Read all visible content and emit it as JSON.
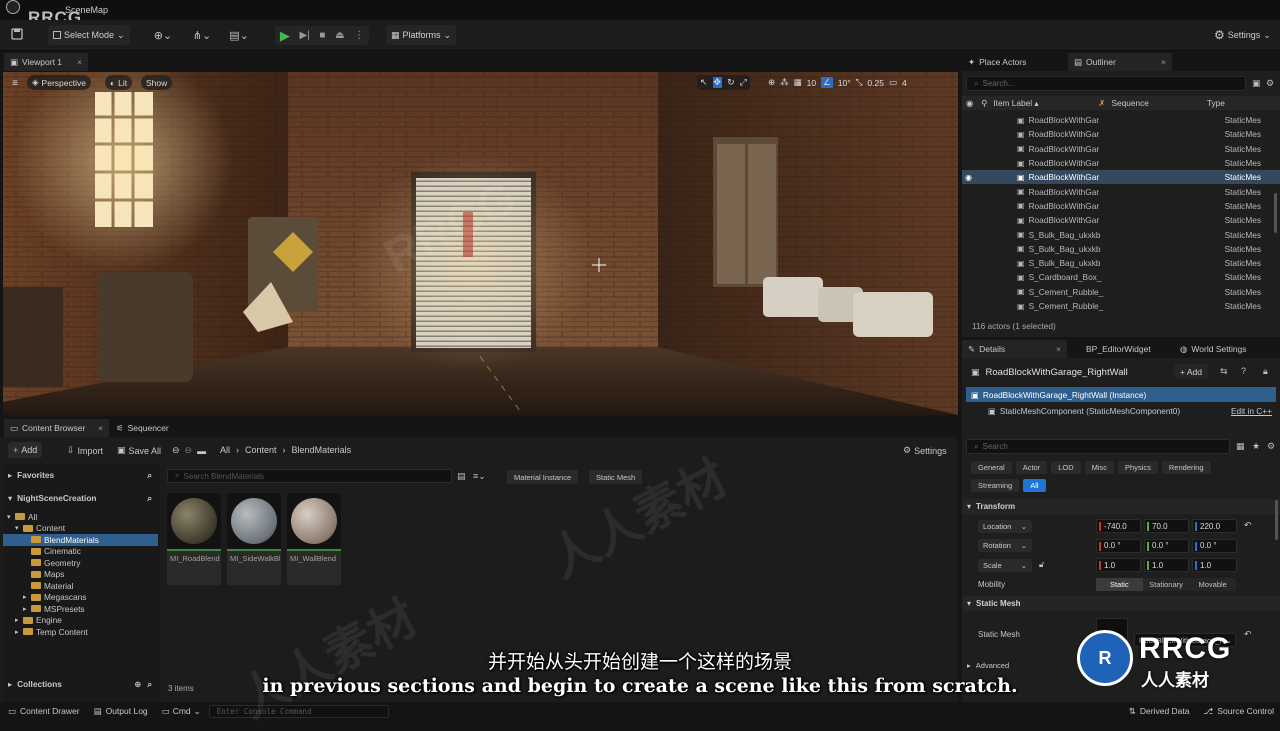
{
  "app": {
    "window_title": "SceneMap",
    "logo_text": "RRCG"
  },
  "toolbar": {
    "select_mode": "Select Mode",
    "platforms": "Platforms",
    "settings": "Settings"
  },
  "viewport": {
    "tab": "Viewport 1",
    "perspective": "Perspective",
    "lit": "Lit",
    "show": "Show",
    "angle_snap": "10°",
    "scale_snap": "0.25",
    "grid_snap": "10",
    "camera_speed": "4"
  },
  "outliner": {
    "tabs": [
      "Place Actors",
      "Outliner"
    ],
    "search_placeholder": "Search...",
    "columns": {
      "label": "Item Label ▴",
      "sequence": "Sequence",
      "type": "Type"
    },
    "rows": [
      {
        "label": "RoadBlockWithGar",
        "type": "StaticMes",
        "selected": false
      },
      {
        "label": "RoadBlockWithGar",
        "type": "StaticMes",
        "selected": false
      },
      {
        "label": "RoadBlockWithGar",
        "type": "StaticMes",
        "selected": false
      },
      {
        "label": "RoadBlockWithGar",
        "type": "StaticMes",
        "selected": false
      },
      {
        "label": "RoadBlockWithGar",
        "type": "StaticMes",
        "selected": true
      },
      {
        "label": "RoadBlockWithGar",
        "type": "StaticMes",
        "selected": false
      },
      {
        "label": "RoadBlockWithGar",
        "type": "StaticMes",
        "selected": false
      },
      {
        "label": "RoadBlockWithGar",
        "type": "StaticMes",
        "selected": false
      },
      {
        "label": "S_Bulk_Bag_ukxkb",
        "type": "StaticMes",
        "selected": false
      },
      {
        "label": "S_Bulk_Bag_ukxkb",
        "type": "StaticMes",
        "selected": false
      },
      {
        "label": "S_Bulk_Bag_ukxkb",
        "type": "StaticMes",
        "selected": false
      },
      {
        "label": "S_Cardboard_Box_",
        "type": "StaticMes",
        "selected": false
      },
      {
        "label": "S_Cement_Rubble_",
        "type": "StaticMes",
        "selected": false
      },
      {
        "label": "S_Cement_Rubble_",
        "type": "StaticMes",
        "selected": false
      }
    ],
    "status": "116 actors (1 selected)"
  },
  "details": {
    "tabs": [
      "Details",
      "BP_EditorWidget",
      "World Settings"
    ],
    "actor_name": "RoadBlockWithGarage_RightWall",
    "add_label": "+ Add",
    "instance_label": "RoadBlockWithGarage_RightWall (Instance)",
    "component_label": "StaticMeshComponent (StaticMeshComponent0)",
    "edit_in_cpp": "Edit in C++",
    "search_placeholder": "Search",
    "filters": [
      "General",
      "Actor",
      "LOD",
      "Misc",
      "Physics",
      "Rendering"
    ],
    "filters2": [
      "Streaming",
      "All"
    ],
    "transform_header": "Transform",
    "location_label": "Location",
    "rotation_label": "Rotation",
    "scale_label": "Scale",
    "location": [
      "-740.0",
      "70.0",
      "220.0"
    ],
    "rotation": [
      "0.0 °",
      "0.0 °",
      "0.0 °"
    ],
    "scale": [
      "1.0",
      "1.0",
      "1.0"
    ],
    "mobility_label": "Mobility",
    "mobility_options": [
      "Static",
      "Stationary",
      "Movable"
    ],
    "static_mesh_header": "Static Mesh",
    "static_mesh_label": "Static Mesh",
    "static_mesh_value": "RoadBlockWithGarage_R",
    "advanced_label": "Advanced",
    "axis_colors": [
      "#c0392b",
      "#5fa83b",
      "#2e6fd1"
    ]
  },
  "content_browser": {
    "tabs": [
      "Content Browser",
      "Sequencer"
    ],
    "add_label": "Add",
    "import_label": "Import",
    "save_all_label": "Save All",
    "breadcrumb": [
      "All",
      "Content",
      "BlendMaterials"
    ],
    "settings_label": "Settings",
    "favorites": "Favorites",
    "project": "NightSceneCreation",
    "tree": [
      {
        "label": "All",
        "depth": 0,
        "selected": false
      },
      {
        "label": "Content",
        "depth": 1,
        "selected": false
      },
      {
        "label": "BlendMaterials",
        "depth": 2,
        "selected": true
      },
      {
        "label": "Cinematic",
        "depth": 2,
        "selected": false
      },
      {
        "label": "Geometry",
        "depth": 2,
        "selected": false
      },
      {
        "label": "Maps",
        "depth": 2,
        "selected": false
      },
      {
        "label": "Material",
        "depth": 2,
        "selected": false
      },
      {
        "label": "Megascans",
        "depth": 2,
        "selected": false
      },
      {
        "label": "MSPresets",
        "depth": 2,
        "selected": false
      },
      {
        "label": "Engine",
        "depth": 1,
        "selected": false
      },
      {
        "label": "Temp Content",
        "depth": 1,
        "selected": false
      }
    ],
    "collections": "Collections",
    "search_placeholder": "Search BlendMaterials",
    "filter_chips": [
      "Material Instance",
      "Static Mesh"
    ],
    "assets": [
      "MI_RoadBlend",
      "MI_SideWalkBlend",
      "MI_WallBlend"
    ],
    "item_count": "3 items"
  },
  "bottom_bar": {
    "content_drawer": "Content Drawer",
    "output_log": "Output Log",
    "cmd": "Cmd",
    "console_placeholder": "Enter Console Command",
    "derived_data": "Derived Data",
    "source_control": "Source Control"
  },
  "subtitles": {
    "chinese": "并开始从头开始创建一个这样的场景",
    "english": "in previous sections and begin to create a scene like this from scratch."
  },
  "watermark": {
    "brand": "RRCG",
    "tagline": "人人素材"
  }
}
